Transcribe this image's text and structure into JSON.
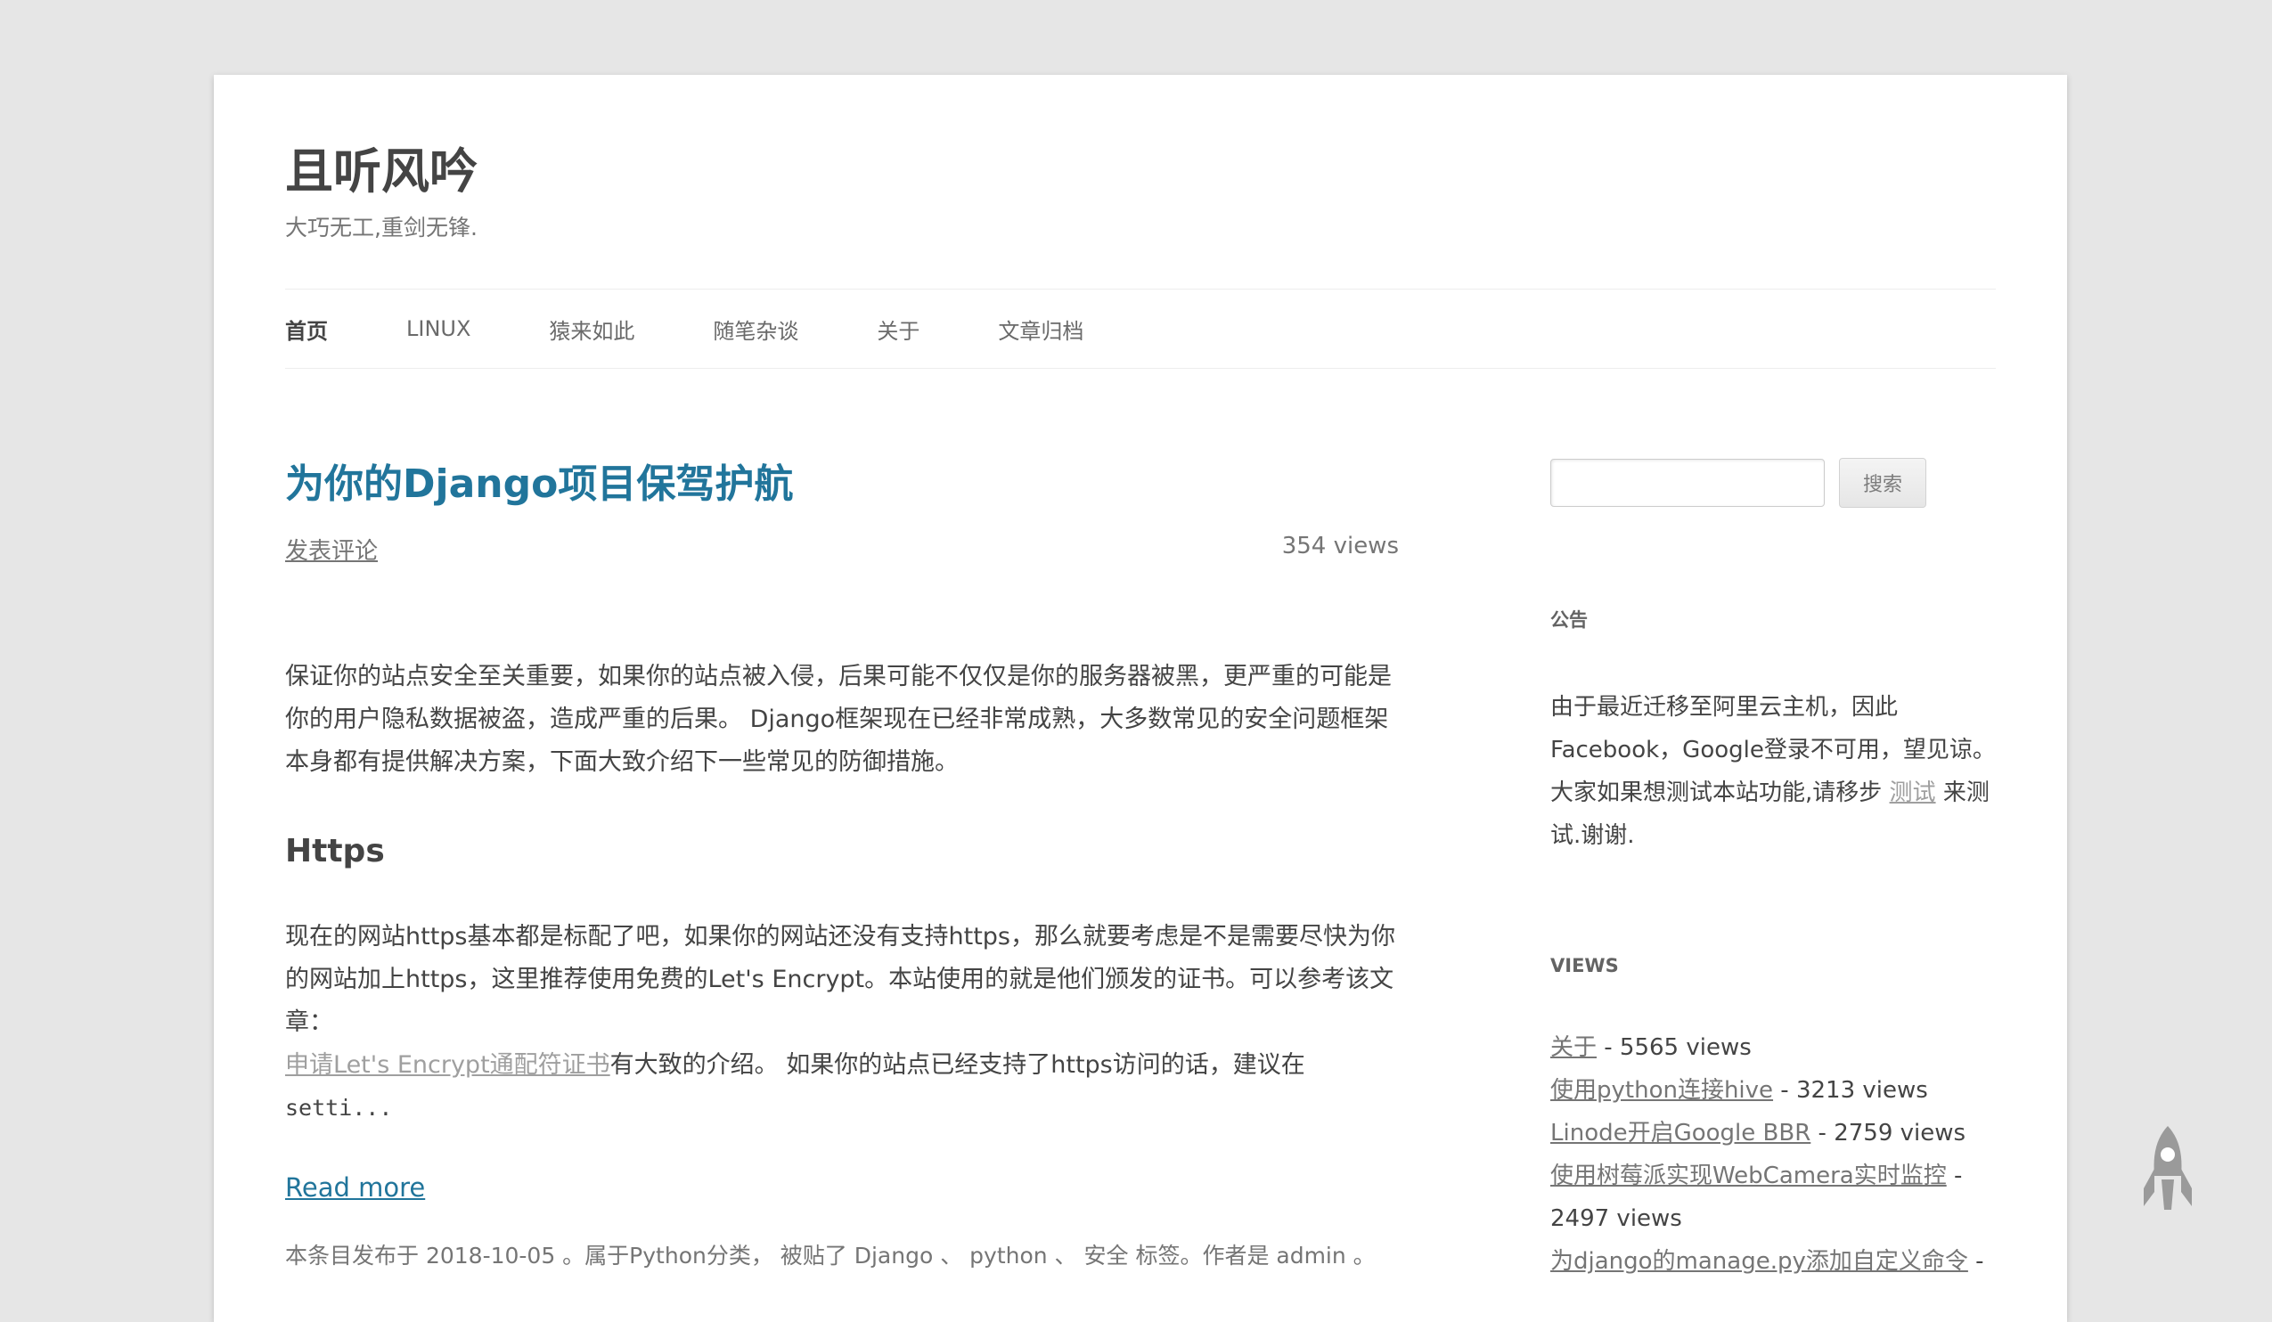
{
  "site": {
    "title": "且听风吟",
    "description": "大巧无工,重剑无锋."
  },
  "nav": {
    "items": [
      {
        "label": "首页",
        "current": true
      },
      {
        "label": "LINUX"
      },
      {
        "label": "猿来如此"
      },
      {
        "label": "随笔杂谈"
      },
      {
        "label": "关于"
      },
      {
        "label": "文章归档"
      }
    ]
  },
  "post": {
    "title": "为你的Django项目保驾护航",
    "comment_link": "发表评论",
    "views": "354 views",
    "intro": "保证你的站点安全至关重要，如果你的站点被入侵，后果可能不仅仅是你的服务器被黑，更严重的可能是你的用户隐私数据被盗，造成严重的后果。 Django框架现在已经非常成熟，大多数常见的安全问题框架本身都有提供解决方案，下面大致介绍下一些常见的防御措施。",
    "section_heading": "Https",
    "section_text_before_link": "现在的网站https基本都是标配了吧，如果你的网站还没有支持https，那么就要考虑是不是需要尽快为你的网站加上https，这里推荐使用免费的Let's Encrypt。本站使用的就是他们颁发的证书。可以参考该文章：",
    "section_link": "申请Let's Encrypt通配符证书",
    "section_text_after_link": "有大致的介绍。 如果你的站点已经支持了https访问的话，建议在",
    "section_code_fragment": "setti...",
    "read_more": "Read more",
    "entry_footer": "本条目发布于 2018-10-05 。属于Python分类， 被贴了 Django 、 python 、 安全 标签。作者是 admin 。"
  },
  "sidebar": {
    "search": {
      "input_value": "",
      "button_label": "搜索"
    },
    "notice": {
      "title": "公告",
      "text_before_link": "由于最近迁移至阿里云主机，因此Facebook，Google登录不可用，望见谅。大家如果想测试本站功能,请移步",
      "link": "测试",
      "text_after_link": "来测试.谢谢."
    },
    "views": {
      "title": "VIEWS",
      "items": [
        {
          "title": "关于",
          "count": " - 5565 views"
        },
        {
          "title": "使用python连接hive",
          "count": " - 3213 views"
        },
        {
          "title": "Linode开启Google BBR",
          "count": " - 2759 views"
        },
        {
          "title": "使用树莓派实现WebCamera实时监控",
          "count": " - 2497 views"
        },
        {
          "title": "为django的manage.py添加自定义命令",
          "count": " -"
        }
      ]
    }
  },
  "icons": {
    "back_to_top": "rocket-icon"
  },
  "colors": {
    "link_blue": "#21759b",
    "page_bg": "#e6e6e6",
    "content_bg": "#ffffff",
    "muted_link": "#9f9f9f"
  }
}
